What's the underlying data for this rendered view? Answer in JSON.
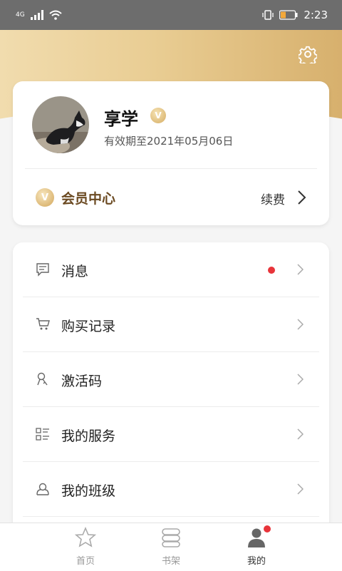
{
  "status_bar": {
    "network": "4G",
    "time": "2:23"
  },
  "profile": {
    "name": "享学",
    "vip_badge": "V",
    "expiry": "有效期至2021年05月06日"
  },
  "vip_center": {
    "icon_letter": "V",
    "label": "会员中心",
    "renew": "续费"
  },
  "menu": {
    "items": [
      {
        "label": "消息",
        "icon": "message-icon",
        "has_dot": true
      },
      {
        "label": "购买记录",
        "icon": "cart-icon"
      },
      {
        "label": "激活码",
        "icon": "key-icon"
      },
      {
        "label": "我的服务",
        "icon": "service-list-icon"
      },
      {
        "label": "我的班级",
        "icon": "class-icon"
      }
    ]
  },
  "tabs": [
    {
      "label": "首页",
      "icon": "star-icon",
      "active": false
    },
    {
      "label": "书架",
      "icon": "bookshelf-icon",
      "active": false
    },
    {
      "label": "我的",
      "icon": "person-icon",
      "active": true
    }
  ],
  "colors": {
    "accent_gold": "#d7b06d",
    "notification_red": "#e8343a"
  }
}
